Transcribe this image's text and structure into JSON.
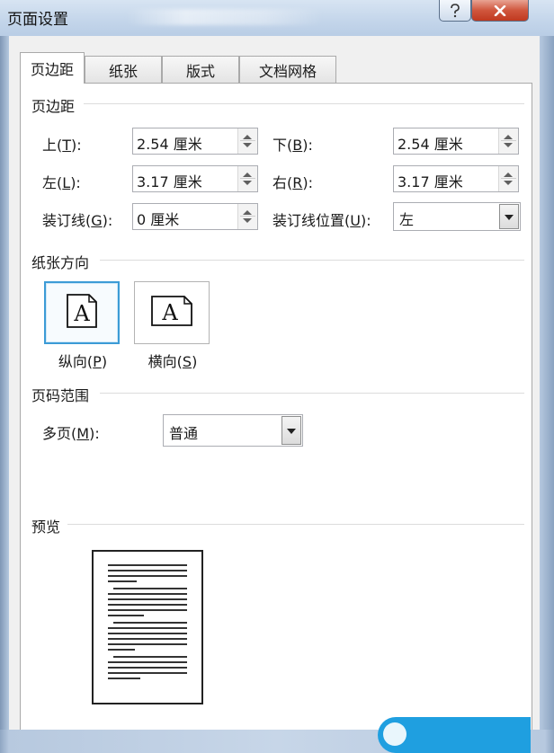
{
  "window": {
    "title": "页面设置"
  },
  "tabs": [
    {
      "label": "页边距",
      "active": true
    },
    {
      "label": "纸张",
      "active": false
    },
    {
      "label": "版式",
      "active": false
    },
    {
      "label": "文档网格",
      "active": false
    }
  ],
  "margins": {
    "section_title": "页边距",
    "top": {
      "label": "上",
      "key": "T",
      "value": "2.54 厘米"
    },
    "bottom": {
      "label": "下",
      "key": "B",
      "value": "2.54 厘米"
    },
    "left": {
      "label": "左",
      "key": "L",
      "value": "3.17 厘米"
    },
    "right": {
      "label": "右",
      "key": "R",
      "value": "3.17 厘米"
    },
    "gutter": {
      "label": "装订线",
      "key": "G",
      "value": "0 厘米"
    },
    "gutter_pos": {
      "label": "装订线位置",
      "key": "U",
      "value": "左"
    }
  },
  "orientation": {
    "section_title": "纸张方向",
    "glyph": "A",
    "portrait": {
      "label": "纵向",
      "key": "P",
      "selected": true
    },
    "landscape": {
      "label": "横向",
      "key": "S",
      "selected": false
    }
  },
  "pages": {
    "section_title": "页码范围",
    "multiple": {
      "label": "多页",
      "key": "M",
      "value": "普通"
    }
  },
  "preview": {
    "section_title": "预览"
  },
  "colors": {
    "accent": "#3c9bd6",
    "close": "#c0391f",
    "badge": "#1f9fe0"
  },
  "icons": {
    "help": "question-mark-icon",
    "close": "close-x-icon",
    "spin": "spin-arrows-icon",
    "dropdown": "chevron-down-icon"
  }
}
